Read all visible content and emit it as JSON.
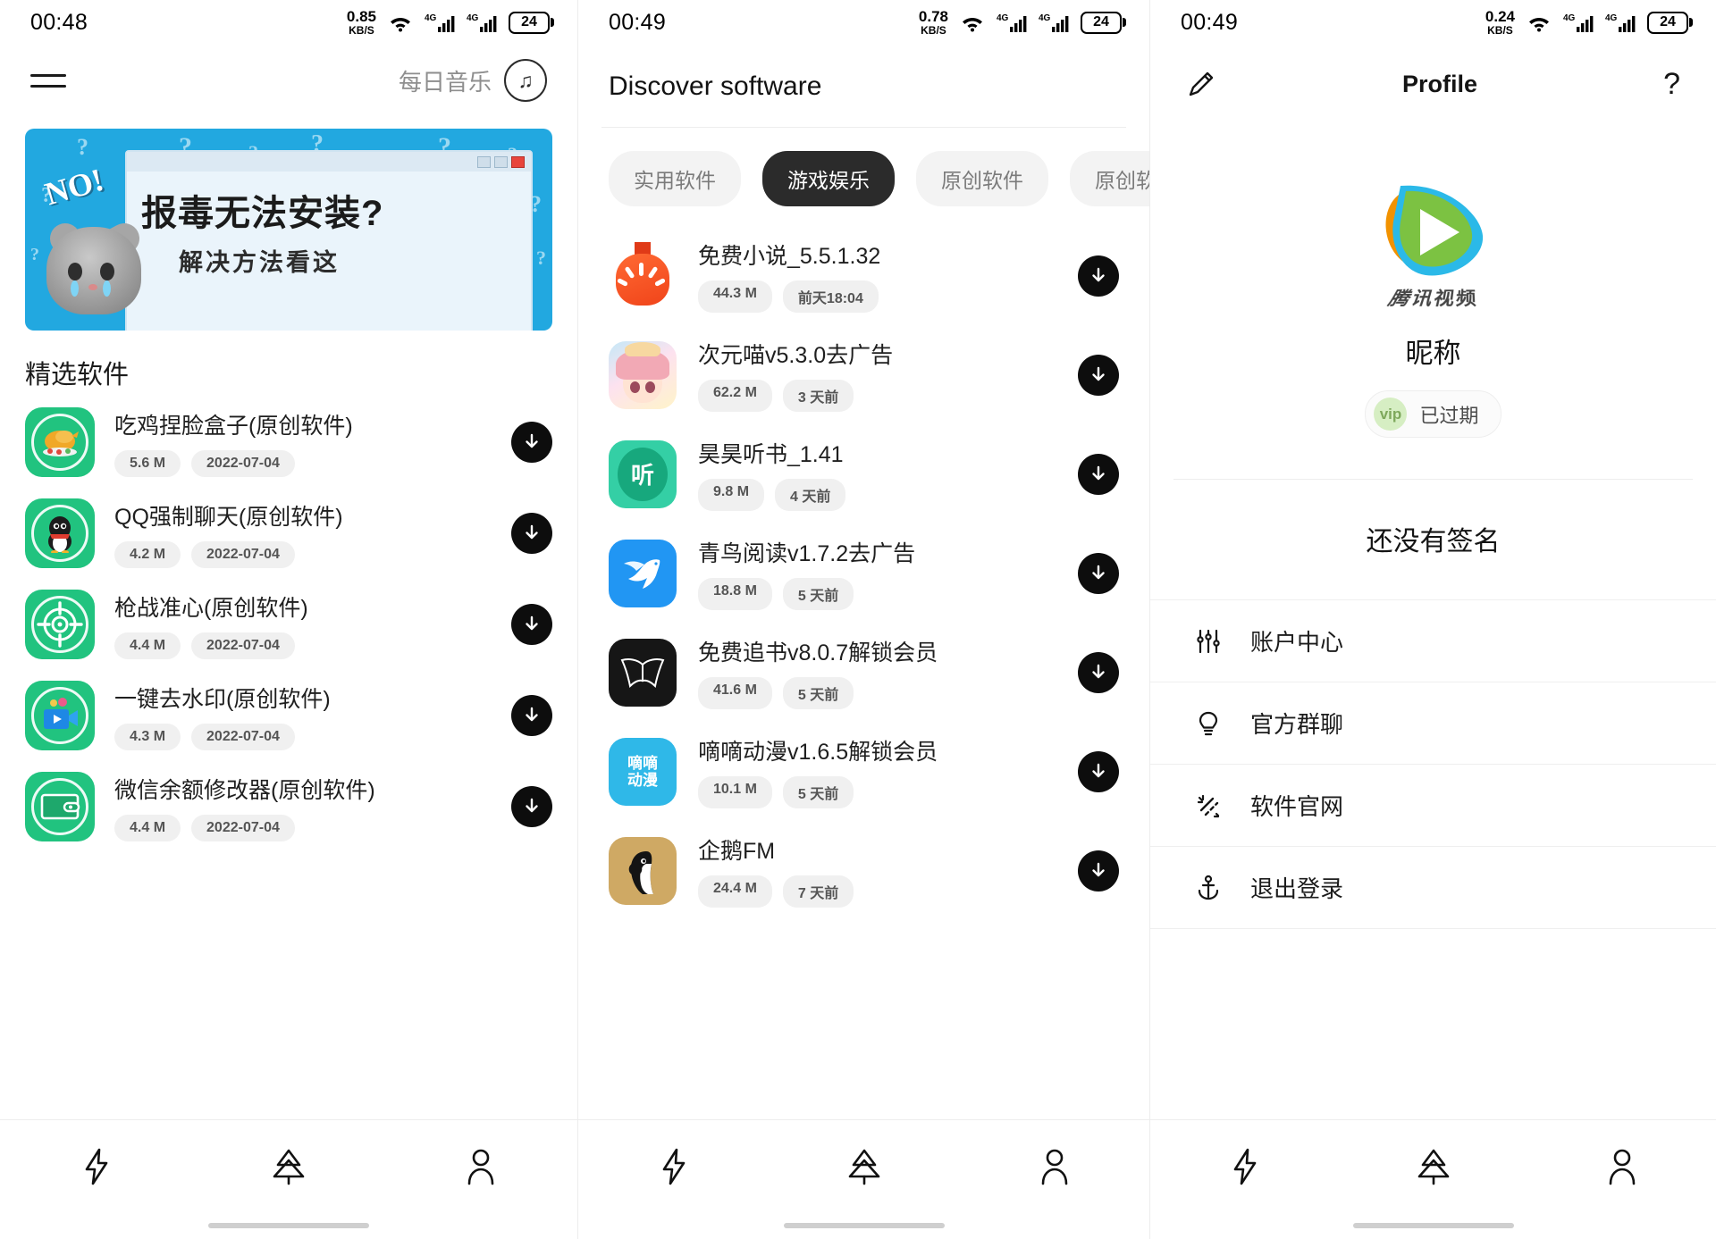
{
  "screens": [
    {
      "statusbar": {
        "time": "00:48",
        "speed_value": "0.85",
        "speed_unit": "KB/S",
        "net1": "4G",
        "net2": "4G",
        "battery": "24"
      },
      "header": {
        "menu_icon": "hamburger-icon",
        "music_label": "每日音乐",
        "music_icon": "music-note-icon"
      },
      "banner": {
        "no_text": "NO!",
        "headline": "报毒无法安装?",
        "subline": "解决方法看这"
      },
      "section_title": "精选软件",
      "apps": [
        {
          "name": "吃鸡捏脸盒子(原创软件)",
          "size": "5.6 M",
          "date": "2022-07-04",
          "icon": "chicken-icon"
        },
        {
          "name": "QQ强制聊天(原创软件)",
          "size": "4.2 M",
          "date": "2022-07-04",
          "icon": "qq-penguin-icon"
        },
        {
          "name": "枪战准心(原创软件)",
          "size": "4.4 M",
          "date": "2022-07-04",
          "icon": "crosshair-icon"
        },
        {
          "name": "一键去水印(原创软件)",
          "size": "4.3 M",
          "date": "2022-07-04",
          "icon": "video-camera-icon"
        },
        {
          "name": "微信余额修改器(原创软件)",
          "size": "4.4 M",
          "date": "2022-07-04",
          "icon": "wallet-icon"
        }
      ]
    },
    {
      "statusbar": {
        "time": "00:49",
        "speed_value": "0.78",
        "speed_unit": "KB/S",
        "net1": "4G",
        "net2": "4G",
        "battery": "24"
      },
      "title": "Discover software",
      "chips": [
        {
          "label": "实用软件",
          "active": false
        },
        {
          "label": "游戏娱乐",
          "active": true
        },
        {
          "label": "原创软件",
          "active": false
        },
        {
          "label": "原创软件",
          "active": false
        }
      ],
      "apps": [
        {
          "name": "免费小说_5.5.1.32",
          "size": "44.3 M",
          "date": "前天18:04",
          "icon": "tomato-novel-icon"
        },
        {
          "name": "次元喵v5.3.0去广告",
          "size": "62.2 M",
          "date": "3 天前",
          "icon": "anime-girl-icon"
        },
        {
          "name": "昊昊听书_1.41",
          "size": "9.8 M",
          "date": "4 天前",
          "icon": "listen-book-icon"
        },
        {
          "name": "青鸟阅读v1.7.2去广告",
          "size": "18.8 M",
          "date": "5 天前",
          "icon": "blue-bird-icon"
        },
        {
          "name": "免费追书v8.0.7解锁会员",
          "size": "41.6 M",
          "date": "5 天前",
          "icon": "open-book-icon"
        },
        {
          "name": "嘀嘀动漫v1.6.5解锁会员",
          "size": "10.1 M",
          "date": "5 天前",
          "icon": "didi-anime-icon"
        },
        {
          "name": "企鹅FM",
          "size": "24.4 M",
          "date": "7 天前",
          "icon": "penguin-fm-icon"
        }
      ],
      "download_icon": "download-arrow-icon"
    },
    {
      "statusbar": {
        "time": "00:49",
        "speed_value": "0.24",
        "speed_unit": "KB/S",
        "net1": "4G",
        "net2": "4G",
        "battery": "24"
      },
      "header": {
        "edit_icon": "pencil-icon",
        "title": "Profile",
        "help_icon": "question-mark-icon"
      },
      "avatar": {
        "icon": "tencent-video-logo",
        "brand_text": "腾讯视频"
      },
      "nickname": "昵称",
      "vip": {
        "badge": "vip",
        "status": "已过期"
      },
      "signature": "还没有签名",
      "menu": [
        {
          "label": "账户中心",
          "icon": "sliders-icon"
        },
        {
          "label": "官方群聊",
          "icon": "lightbulb-icon"
        },
        {
          "label": "软件官网",
          "icon": "sparkle-icon"
        },
        {
          "label": "退出登录",
          "icon": "anchor-icon"
        }
      ]
    }
  ],
  "bottomnav": [
    {
      "icon": "lightning-bolt-icon",
      "active": false
    },
    {
      "icon": "pine-tree-icon",
      "active": false
    },
    {
      "icon": "person-icon",
      "active": false
    }
  ],
  "colors": {
    "accent_green": "#21c37f",
    "dark": "#2b2b2b",
    "banner_blue": "#22a8e0"
  }
}
